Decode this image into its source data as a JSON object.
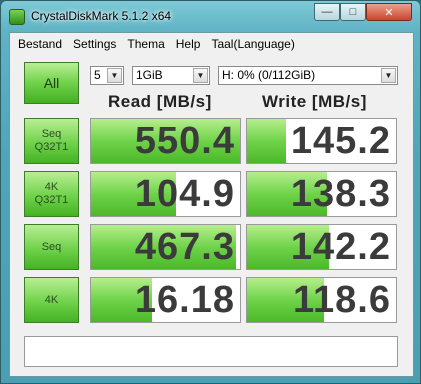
{
  "window": {
    "title": "CrystalDiskMark 5.1.2 x64"
  },
  "menu": [
    "Bestand",
    "Settings",
    "Thema",
    "Help",
    "Taal(Language)"
  ],
  "controls": {
    "all_label": "All",
    "count": "5",
    "size": "1GiB",
    "drive": "H: 0% (0/112GiB)"
  },
  "headers": {
    "read": "Read [MB/s]",
    "write": "Write [MB/s]"
  },
  "rows": [
    {
      "label_line1": "Seq",
      "label_line2": "Q32T1",
      "read": "550.4",
      "write": "145.2",
      "read_fill": 1.0,
      "write_fill": 0.26
    },
    {
      "label_line1": "4K",
      "label_line2": "Q32T1",
      "read": "104.9",
      "write": "138.3",
      "read_fill": 0.57,
      "write_fill": 0.54
    },
    {
      "label_line1": "Seq",
      "label_line2": "",
      "read": "467.3",
      "write": "142.2",
      "read_fill": 0.97,
      "write_fill": 0.55
    },
    {
      "label_line1": "4K",
      "label_line2": "",
      "read": "16.18",
      "write": "118.6",
      "read_fill": 0.41,
      "write_fill": 0.52
    }
  ],
  "comment": ""
}
